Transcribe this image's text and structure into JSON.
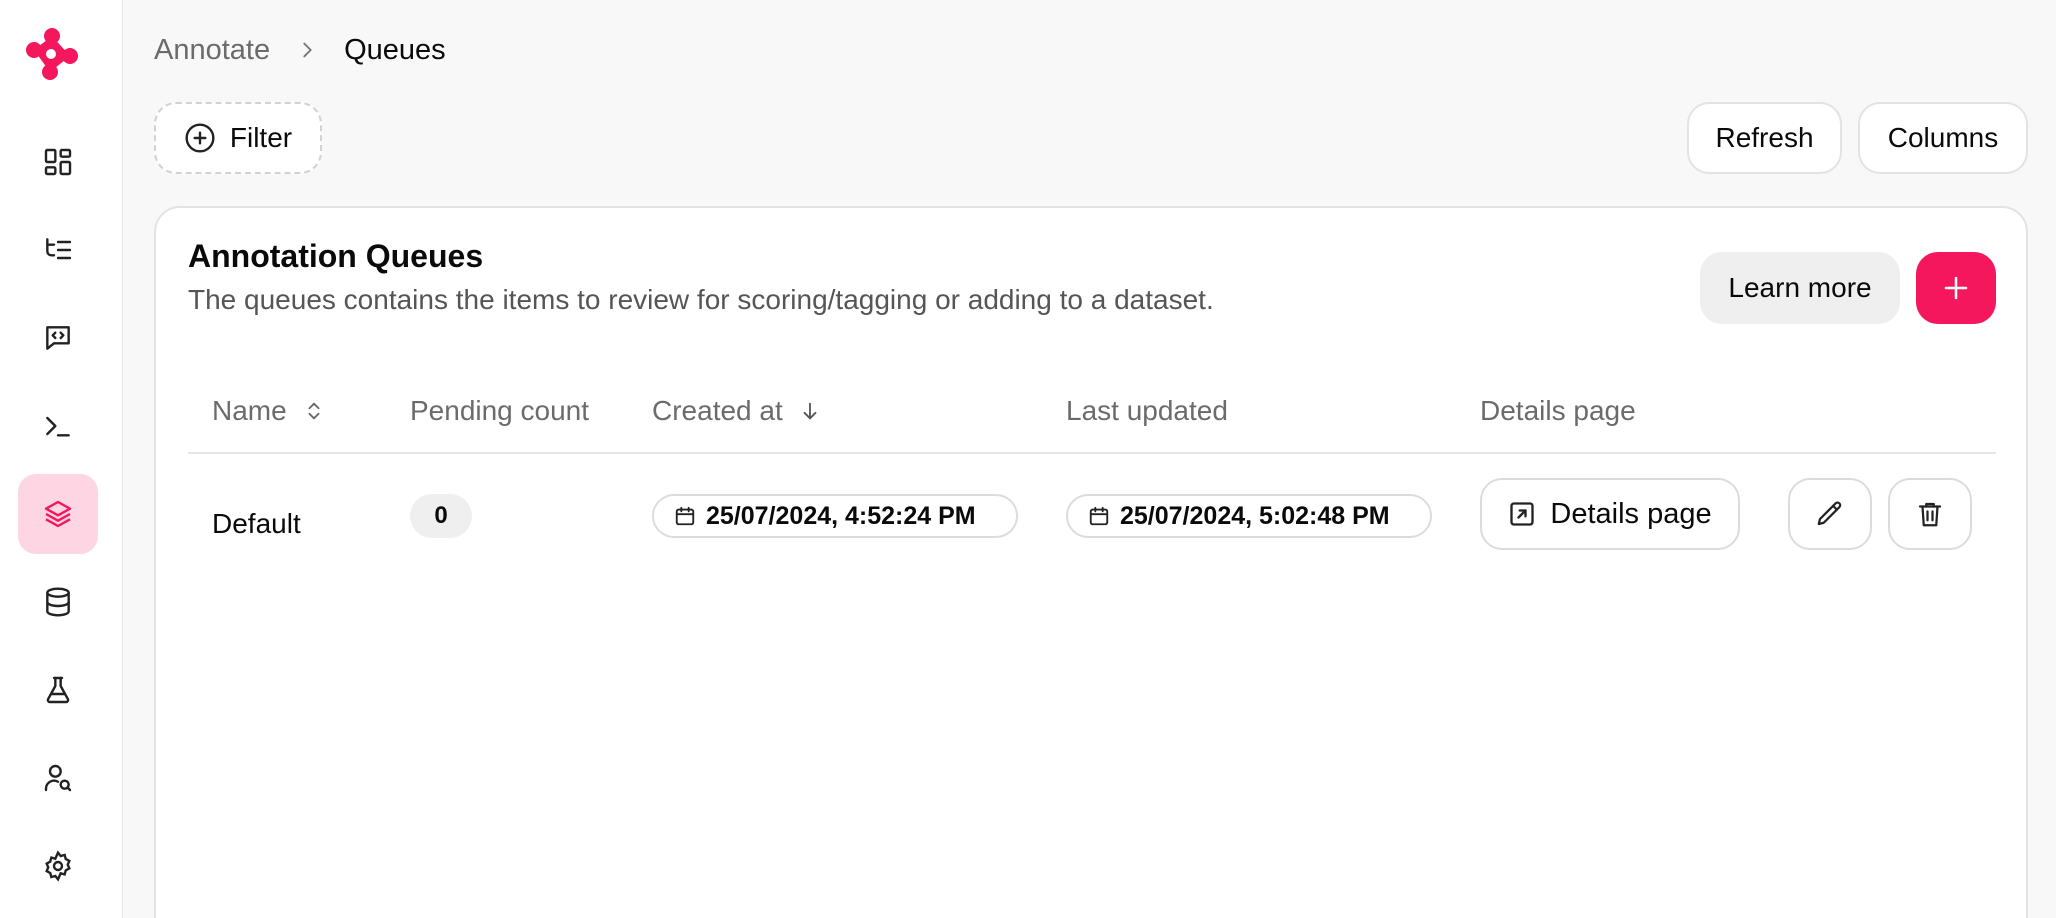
{
  "breadcrumb": {
    "root": "Annotate",
    "current": "Queues"
  },
  "toolbar": {
    "filter_label": "Filter",
    "refresh_label": "Refresh",
    "columns_label": "Columns"
  },
  "sidebar": {
    "items": [
      {
        "name": "dashboard",
        "icon": "dashboard-icon",
        "active": false
      },
      {
        "name": "traces",
        "icon": "list-tree-icon",
        "active": false
      },
      {
        "name": "prompts",
        "icon": "message-code-icon",
        "active": false
      },
      {
        "name": "playground",
        "icon": "terminal-icon",
        "active": false
      },
      {
        "name": "annotation-queues",
        "icon": "layers-icon",
        "active": true
      },
      {
        "name": "datasets",
        "icon": "database-icon",
        "active": false
      },
      {
        "name": "evaluations",
        "icon": "flask-icon",
        "active": false
      },
      {
        "name": "users",
        "icon": "user-search-icon",
        "active": false
      },
      {
        "name": "settings",
        "icon": "gear-icon",
        "active": false
      }
    ]
  },
  "card": {
    "title": "Annotation Queues",
    "description": "The queues contains the items to review for scoring/tagging or adding to a dataset.",
    "learn_more_label": "Learn more"
  },
  "table": {
    "columns": [
      "Name",
      "Pending count",
      "Created at",
      "Last updated",
      "Details page"
    ],
    "rows": [
      {
        "name": "Default",
        "pending_count": "0",
        "created_at": "25/07/2024, 4:52:24 PM",
        "last_updated": "25/07/2024, 5:02:48 PM",
        "details_label": "Details page"
      }
    ]
  },
  "colors": {
    "accent": "#f4175e",
    "active_nav_bg": "#fdd5e3"
  }
}
